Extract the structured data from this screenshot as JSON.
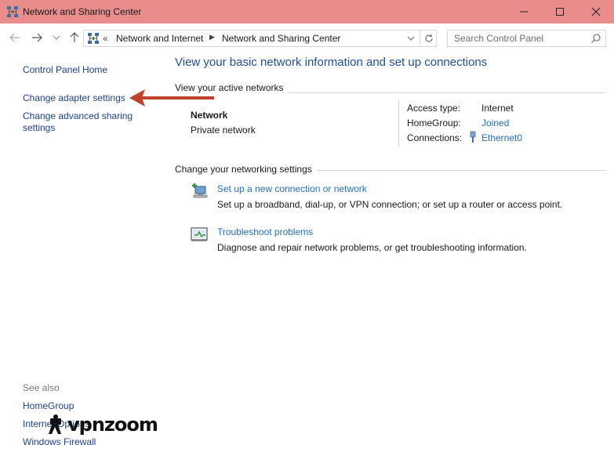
{
  "window": {
    "title": "Network and Sharing Center"
  },
  "address_bar": {
    "overflow_glyph": "«",
    "crumbs": [
      "Network and Internet",
      "Network and Sharing Center"
    ]
  },
  "search": {
    "placeholder": "Search Control Panel"
  },
  "left_pane": {
    "links": [
      "Control Panel Home",
      "Change adapter settings",
      "Change advanced sharing settings"
    ],
    "see_also_label": "See also",
    "see_also_links": [
      "HomeGroup",
      "Internet Options",
      "Windows Firewall"
    ]
  },
  "watermark": {
    "text": "vpnzoom"
  },
  "main": {
    "heading": "View your basic network information and set up connections",
    "active_networks_label": "View your active networks",
    "network": {
      "name": "Network",
      "type": "Private network",
      "access_type_label": "Access type:",
      "access_type_value": "Internet",
      "homegroup_label": "HomeGroup:",
      "homegroup_value": "Joined",
      "connections_label": "Connections:",
      "connections_value": "Ethernet0"
    },
    "change_settings_label": "Change your networking settings",
    "tasks": [
      {
        "icon": "new-connection-icon",
        "title": "Set up a new connection or network",
        "description": "Set up a broadband, dial-up, or VPN connection; or set up a router or access point."
      },
      {
        "icon": "troubleshoot-icon",
        "title": "Troubleshoot problems",
        "description": "Diagnose and repair network problems, or get troubleshooting information."
      }
    ]
  },
  "colors": {
    "titlebar": "#e98c8c",
    "link": "#1f6fc5",
    "heading": "#1f4e9e",
    "arrow": "#c0422a"
  }
}
